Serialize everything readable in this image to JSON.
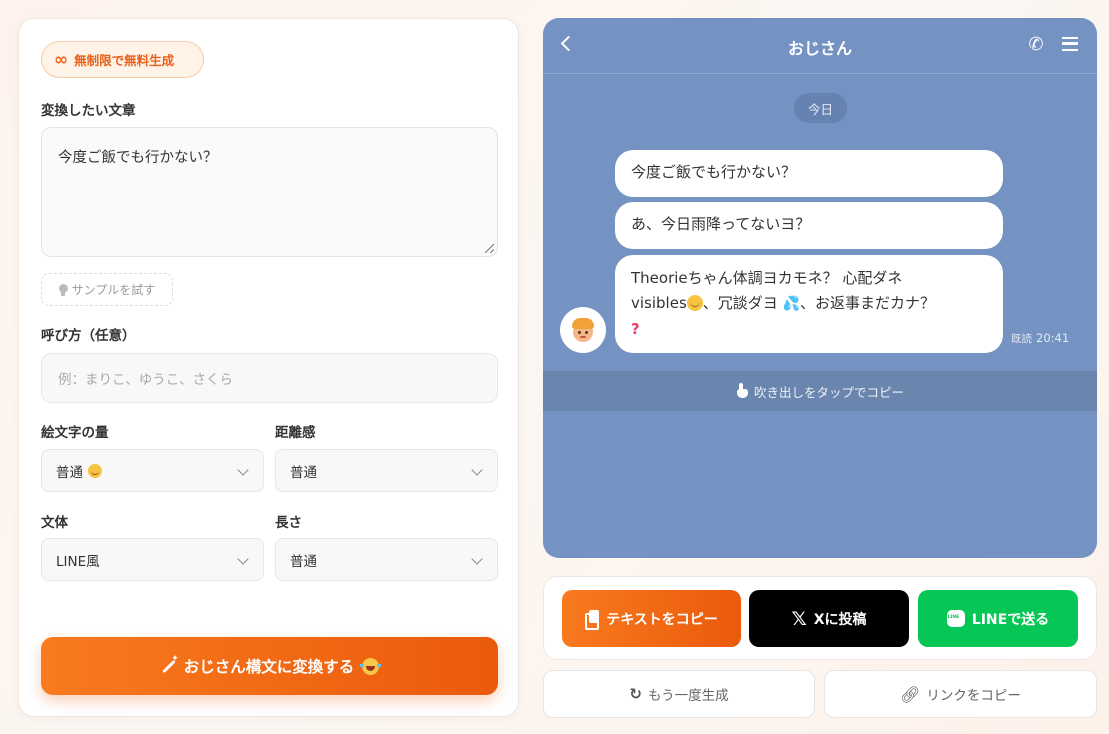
{
  "badge": {
    "icon": "infinity-icon",
    "label": "無制限で無料生成"
  },
  "input_section": {
    "label": "変換したい文章",
    "textarea_value": "今度ご飯でも行かない？",
    "sample_button": "サンプルを試す"
  },
  "name_section": {
    "label": "呼び方（任意）",
    "placeholder": "例：まりこ、ゆうこ、さくら"
  },
  "options": {
    "emoji_label": "絵文字の量",
    "emoji_value": "普通",
    "distance_label": "距離感",
    "distance_value": "普通",
    "style_label": "文体",
    "style_value": "LINE風",
    "length_label": "長さ",
    "length_value": "普通"
  },
  "convert_button": "おじさん構文に変換する",
  "chat": {
    "title": "おじさん",
    "date_chip": "今日",
    "messages": [
      "今度ご飯でも行かない？",
      "あ、今日雨降ってないヨ？"
    ],
    "message3_part1": "Theorieちゃん体調ヨカモネ？ 心配ダネ",
    "message3_part2": "visibles",
    "message3_part3": "、冗談ダヨ",
    "message3_part4": "、お返事まだカナ？",
    "read_label": "既読",
    "time": "20:41",
    "tap_hint": "吹き出しをタップでコピー"
  },
  "actions": {
    "copy_text": "テキストをコピー",
    "post_x": "Xに投稿",
    "send_line": "LINEで送る",
    "regenerate": "もう一度生成",
    "copy_link": "リンクをコピー"
  },
  "colors": {
    "accent": "#f97a1f",
    "chat_bg": "#7493c2",
    "line_green": "#06c755",
    "x_black": "#000000"
  }
}
